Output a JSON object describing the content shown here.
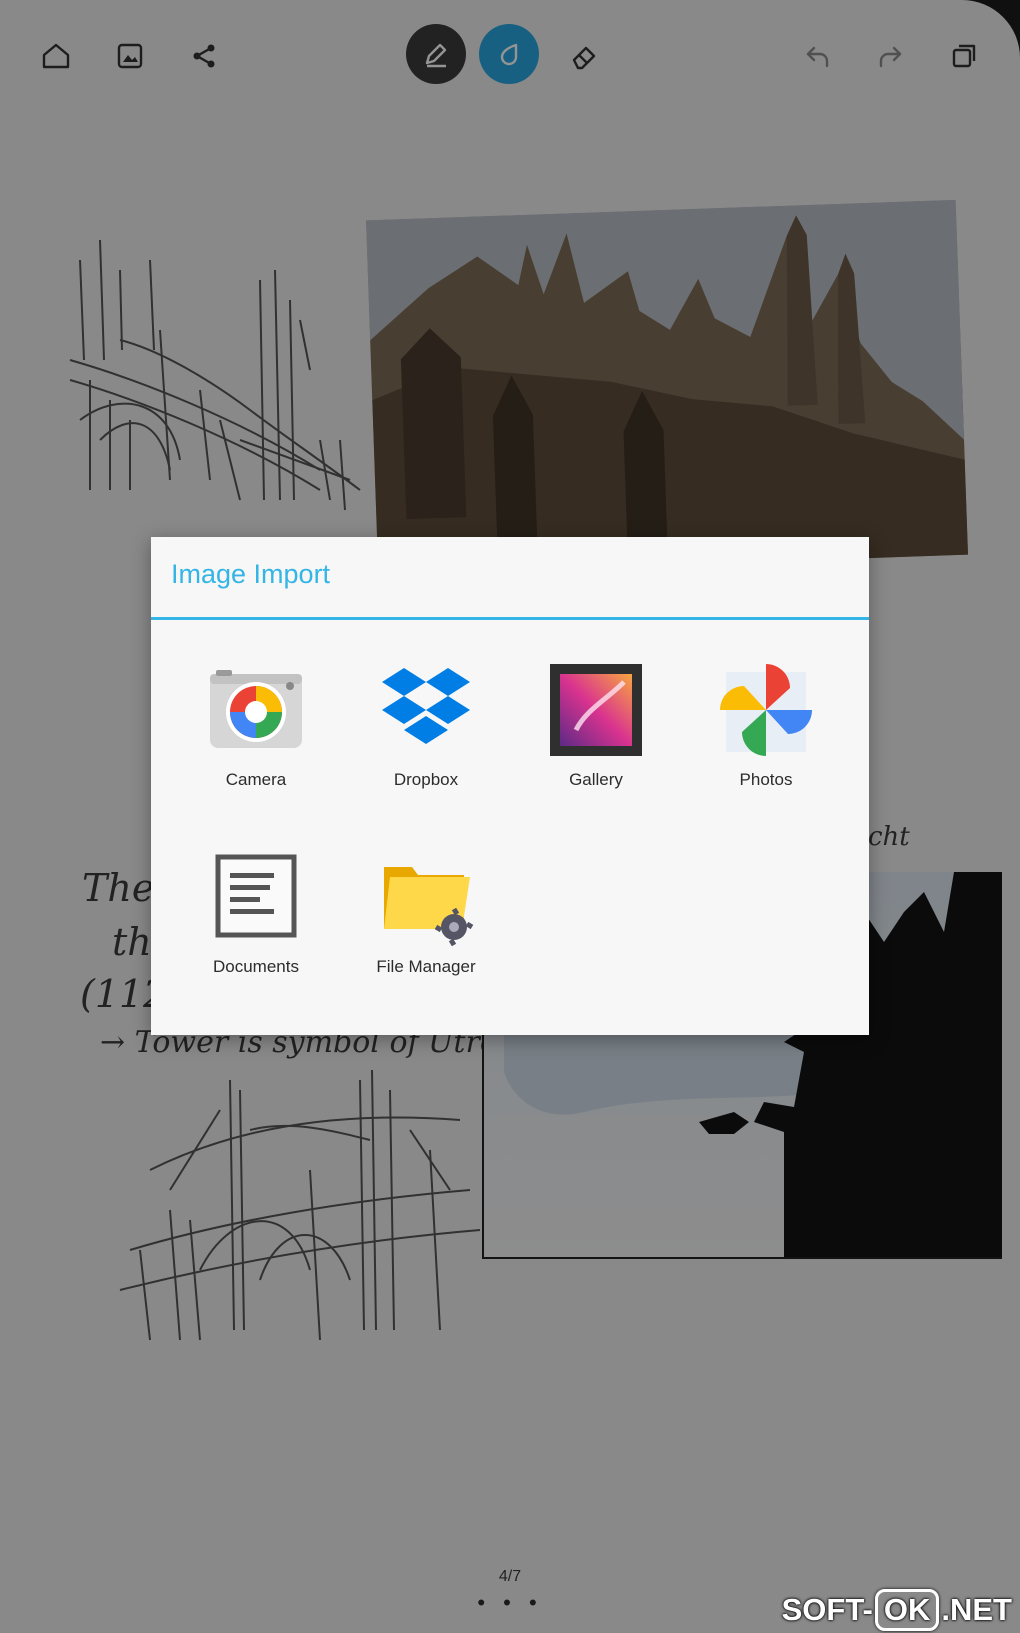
{
  "toolbar": {
    "home": "home-icon",
    "image": "image-icon",
    "share": "share-icon",
    "pen": "pen-icon",
    "ink": "ink-drop-icon",
    "eraser": "eraser-icon",
    "undo": "undo-icon",
    "redo": "redo-icon",
    "pages": "pages-icon",
    "active_color": "#2aa6e0"
  },
  "dialog": {
    "title": "Image Import",
    "accent_color": "#33b5e5",
    "apps": [
      {
        "label": "Camera",
        "icon": "camera-icon"
      },
      {
        "label": "Dropbox",
        "icon": "dropbox-icon"
      },
      {
        "label": "Gallery",
        "icon": "gallery-icon"
      },
      {
        "label": "Photos",
        "icon": "photos-icon"
      },
      {
        "label": "Documents",
        "icon": "documents-icon"
      },
      {
        "label": "File Manager",
        "icon": "file-manager-icon"
      }
    ]
  },
  "canvas": {
    "handwriting": [
      "The",
      "the",
      "(112,5",
      "→ Tower is symbol of Utrecht",
      "cht"
    ]
  },
  "pagination": {
    "indicator": "4/7",
    "dots": "• • •"
  },
  "watermark": {
    "left": "SOFT-",
    "middle": "OK",
    "right": ".NET"
  }
}
